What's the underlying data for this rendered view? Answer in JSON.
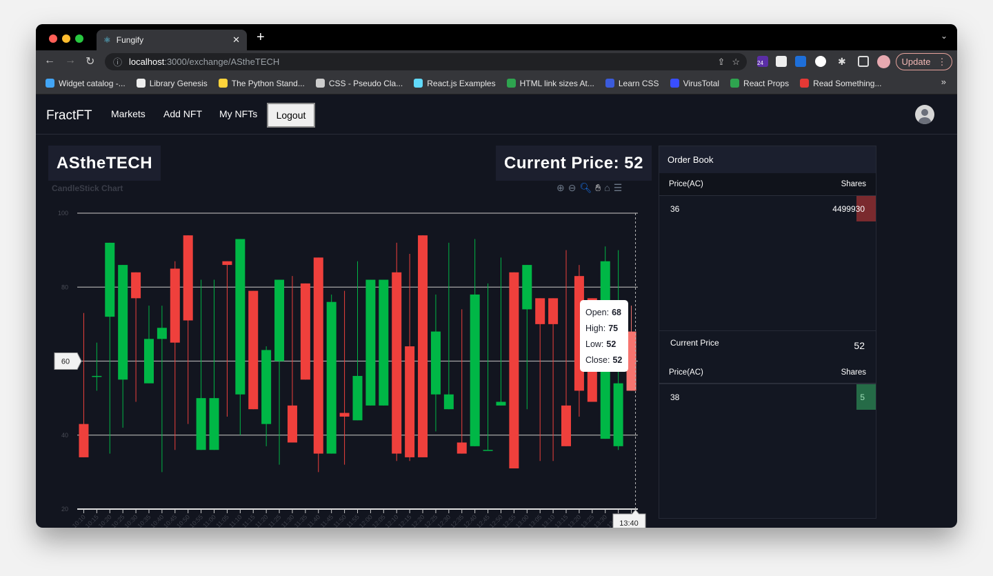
{
  "browser": {
    "tab_title": "Fungify",
    "url_host": "localhost",
    "url_path": ":3000/exchange/AStheTECH",
    "update_label": "Update",
    "extension_badge": "24",
    "bookmarks": [
      {
        "label": "Widget catalog -...",
        "color": "#42a5f5"
      },
      {
        "label": "Library Genesis",
        "color": "#eeeeee"
      },
      {
        "label": "The Python Stand...",
        "color": "#ffd43b"
      },
      {
        "label": "CSS - Pseudo Cla...",
        "color": "#cccccc"
      },
      {
        "label": "React.js Examples",
        "color": "#61dafb"
      },
      {
        "label": "HTML link sizes At...",
        "color": "#2ea44f"
      },
      {
        "label": "Learn CSS",
        "color": "#3b5bdb"
      },
      {
        "label": "VirusTotal",
        "color": "#394eff"
      },
      {
        "label": "React Props",
        "color": "#2ea44f"
      },
      {
        "label": "Read Something...",
        "color": "#e53935"
      }
    ]
  },
  "navbar": {
    "brand": "FractFT",
    "links": [
      "Markets",
      "Add NFT",
      "My NFTs"
    ],
    "logout": "Logout"
  },
  "asset": {
    "name": "AStheTECH",
    "current_price_label": "Current Price: 52"
  },
  "chart_toolbar": [
    "zoom-in-icon",
    "zoom-out-icon",
    "selection-zoom-icon",
    "pan-icon",
    "reset-home-icon",
    "menu-icon"
  ],
  "chart_data": {
    "type": "candlestick",
    "title": "CandleStick Chart",
    "ylim": [
      20,
      100
    ],
    "yticks": [
      "100",
      "80",
      "60",
      "40",
      "20"
    ],
    "grid": true,
    "colors": {
      "up": "#00b746",
      "down": "#ef403c",
      "hover": "#f7746f"
    },
    "categories": [
      "10:10",
      "10:15",
      "10:20",
      "10:25",
      "10:30",
      "10:35",
      "10:40",
      "10:45",
      "10:50",
      "10:55",
      "11:00",
      "11:05",
      "11:10",
      "11:15",
      "11:20",
      "11:25",
      "11:30",
      "11:35",
      "11:40",
      "11:45",
      "11:50",
      "11:55",
      "12:00",
      "12:05",
      "12:10",
      "12:15",
      "12:20",
      "12:25",
      "12:30",
      "12:35",
      "12:40",
      "12:45",
      "12:50",
      "12:55",
      "13:00",
      "13:05",
      "13:10",
      "13:15",
      "13:20",
      "13:25",
      "13:30",
      "13:35",
      "13:40"
    ],
    "ohlc": [
      [
        43,
        73,
        34,
        34
      ],
      [
        56,
        65,
        52,
        56
      ],
      [
        72,
        92,
        35,
        92
      ],
      [
        55,
        86,
        42,
        86
      ],
      [
        84,
        84,
        49,
        77
      ],
      [
        54,
        75,
        54,
        66
      ],
      [
        66,
        75,
        30,
        69
      ],
      [
        85,
        87,
        36,
        65
      ],
      [
        94,
        94,
        43,
        71
      ],
      [
        36,
        82,
        36,
        50
      ],
      [
        36,
        82,
        36,
        50
      ],
      [
        87,
        87,
        45,
        86
      ],
      [
        51,
        93,
        40,
        93
      ],
      [
        79,
        79,
        47,
        47
      ],
      [
        43,
        64,
        37,
        63
      ],
      [
        60,
        82,
        32,
        82
      ],
      [
        48,
        83,
        38,
        38
      ],
      [
        81,
        81,
        55,
        55
      ],
      [
        88,
        88,
        30,
        35
      ],
      [
        35,
        78,
        35,
        76
      ],
      [
        46,
        79,
        32,
        45
      ],
      [
        44,
        87,
        44,
        56
      ],
      [
        48,
        82,
        48,
        82
      ],
      [
        48,
        82,
        48,
        82
      ],
      [
        84,
        92,
        33,
        35
      ],
      [
        64,
        89,
        33,
        34
      ],
      [
        94,
        94,
        34,
        34
      ],
      [
        51,
        78,
        41,
        68
      ],
      [
        47,
        92,
        47,
        51
      ],
      [
        38,
        74,
        35,
        35
      ],
      [
        37,
        93,
        37,
        78
      ],
      [
        36,
        81,
        36,
        36
      ],
      [
        48,
        88,
        48,
        49
      ],
      [
        84,
        84,
        31,
        31
      ],
      [
        74,
        86,
        47,
        86
      ],
      [
        77,
        77,
        33,
        70
      ],
      [
        77,
        77,
        33,
        70
      ],
      [
        48,
        90,
        37,
        37
      ],
      [
        83,
        86,
        45,
        52
      ],
      [
        77,
        77,
        49,
        49
      ],
      [
        39,
        91,
        39,
        87
      ],
      [
        37,
        90,
        36,
        54
      ],
      [
        68,
        75,
        52,
        52
      ]
    ],
    "hover_index": 42,
    "crosshair": {
      "x_label": "13:40",
      "y_label": "60"
    },
    "tooltip": {
      "open_label": "Open:",
      "open": "68",
      "high_label": "High:",
      "high": "75",
      "low_label": "Low:",
      "low": "52",
      "close_label": "Close:",
      "close": "52"
    }
  },
  "order_book": {
    "title": "Order Book",
    "col_price": "Price(AC)",
    "col_shares": "Shares",
    "sells": [
      {
        "price": "36",
        "shares": "4499930"
      }
    ],
    "current_price_label": "Current Price",
    "current_price": "52",
    "buys": [
      {
        "price": "38",
        "shares": "5"
      }
    ],
    "sell_color": "#7a2a2e",
    "buy_color": "#256b47"
  }
}
